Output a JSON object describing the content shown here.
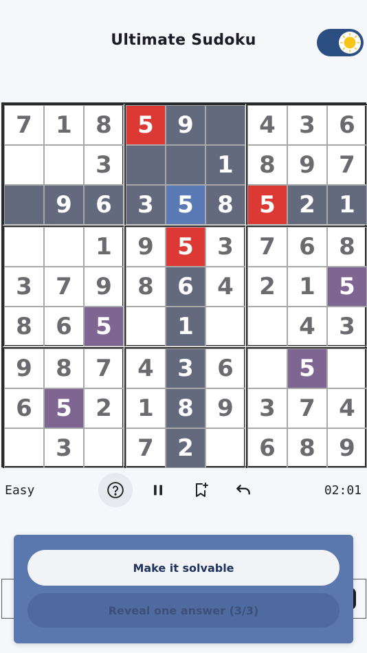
{
  "app": {
    "title": "Ultimate Sudoku"
  },
  "theme_toggle": {
    "state": "light",
    "icon": "sun-icon",
    "track_color": "#2c4f82",
    "sun_color": "#f5c518"
  },
  "board": {
    "grid": [
      [
        "7",
        "1",
        "8",
        "5",
        "9",
        "",
        "4",
        "3",
        "6"
      ],
      [
        "",
        "",
        "3",
        "",
        "",
        "1",
        "8",
        "9",
        "7"
      ],
      [
        "",
        "9",
        "6",
        "3",
        "5",
        "8",
        "5",
        "2",
        "1"
      ],
      [
        "",
        "",
        "1",
        "9",
        "5",
        "3",
        "7",
        "6",
        "8"
      ],
      [
        "3",
        "7",
        "9",
        "8",
        "6",
        "4",
        "2",
        "1",
        "5"
      ],
      [
        "8",
        "6",
        "5",
        "",
        "1",
        "",
        "",
        "4",
        "3"
      ],
      [
        "9",
        "8",
        "7",
        "4",
        "3",
        "6",
        "",
        "5",
        ""
      ],
      [
        "6",
        "5",
        "2",
        "1",
        "8",
        "9",
        "3",
        "7",
        "4"
      ],
      [
        "",
        "3",
        "",
        "7",
        "2",
        "",
        "6",
        "8",
        "9"
      ]
    ],
    "selected_cell": [
      2,
      4
    ],
    "error_cells": [
      [
        0,
        3
      ],
      [
        2,
        6
      ],
      [
        3,
        4
      ]
    ],
    "same_number_cells": [
      [
        4,
        8
      ],
      [
        5,
        2
      ],
      [
        6,
        7
      ],
      [
        7,
        1
      ]
    ],
    "highlighted_cells": [
      [
        0,
        4
      ],
      [
        0,
        5
      ],
      [
        1,
        3
      ],
      [
        1,
        4
      ],
      [
        1,
        5
      ],
      [
        2,
        0
      ],
      [
        2,
        1
      ],
      [
        2,
        2
      ],
      [
        2,
        3
      ],
      [
        2,
        5
      ],
      [
        2,
        7
      ],
      [
        2,
        8
      ],
      [
        4,
        4
      ],
      [
        5,
        4
      ],
      [
        6,
        4
      ],
      [
        7,
        4
      ],
      [
        8,
        4
      ]
    ],
    "colors": {
      "highlight": "#636a7d",
      "selected": "#5a7ab6",
      "error": "#dd3934",
      "same_number": "#7e6592",
      "digit": "#6a6a6f"
    }
  },
  "controls": {
    "difficulty": "Easy",
    "timer": "02:01",
    "buttons": [
      {
        "name": "help-button",
        "icon": "help-icon"
      },
      {
        "name": "pause-button",
        "icon": "pause-icon"
      },
      {
        "name": "bookmark-button",
        "icon": "bookmark-add-icon"
      },
      {
        "name": "undo-button",
        "icon": "undo-icon"
      }
    ]
  },
  "popup": {
    "primary_label": "Make it solvable",
    "secondary_label": "Reveal one answer (3/3)"
  }
}
